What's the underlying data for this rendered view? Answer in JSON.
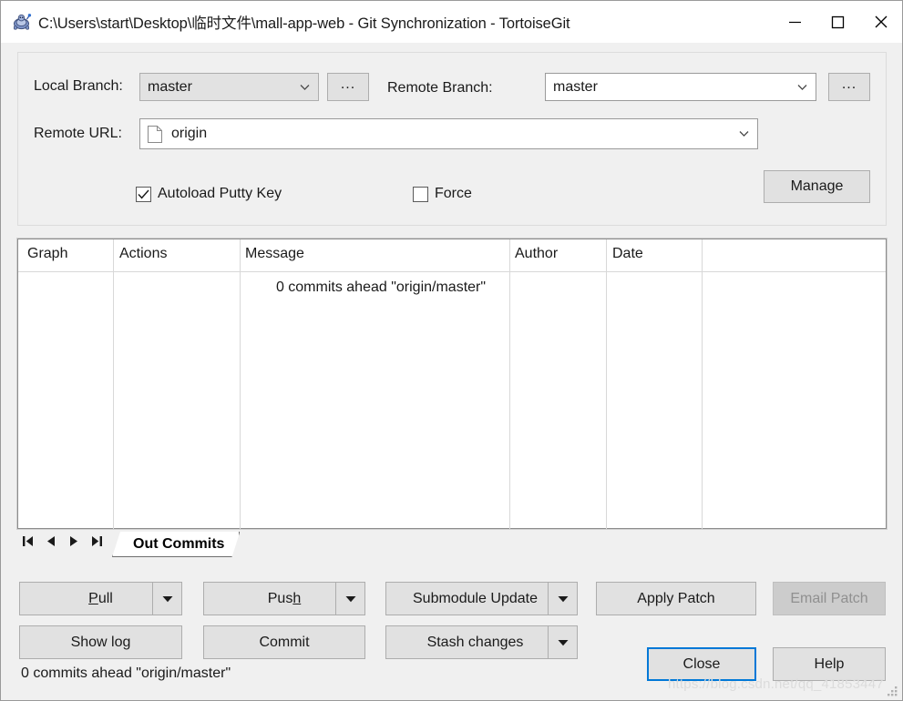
{
  "window": {
    "title": "C:\\Users\\start\\Desktop\\临时文件\\mall-app-web - Git Synchronization - TortoiseGit",
    "app_icon": "tortoisegit-turtle-icon",
    "minimize_label": "—",
    "maximize_label": "☐",
    "close_label": "✕"
  },
  "settings": {
    "local_branch": {
      "label": "Local Branch:",
      "value": "master"
    },
    "local_branch_browse": {
      "label": "..."
    },
    "remote_branch": {
      "label": "Remote Branch:",
      "value": "master"
    },
    "remote_branch_browse": {
      "label": "..."
    },
    "remote_url": {
      "label": "Remote URL:",
      "value": "origin",
      "icon": "document-icon"
    },
    "manage_button": {
      "label": "Manage"
    },
    "autoload_putty_key": {
      "label": "Autoload Putty Key",
      "checked": true,
      "mark": "✓"
    },
    "force": {
      "label": "Force",
      "checked": false,
      "mark": ""
    }
  },
  "commit_list": {
    "columns": [
      "Graph",
      "Actions",
      "Message",
      "Author",
      "Date"
    ],
    "rows": [],
    "empty_message": "0 commits ahead \"origin/master\""
  },
  "tabs": {
    "nav": {
      "first": "⏮",
      "prev": "◀",
      "next": "▶",
      "last": "⏭"
    },
    "active_tab": "Out Commits"
  },
  "actions": {
    "pull": {
      "label": "Pull",
      "accel": "P",
      "has_dropdown": true,
      "dropdown": "▼"
    },
    "push": {
      "label": "Push",
      "accel": "h",
      "has_dropdown": true,
      "dropdown": "▼"
    },
    "submodule_update": {
      "label": "Submodule Update",
      "has_dropdown": true,
      "dropdown": "▼"
    },
    "apply_patch": {
      "label": "Apply Patch"
    },
    "email_patch": {
      "label": "Email Patch",
      "disabled": true
    },
    "show_log": {
      "label": "Show log"
    },
    "commit": {
      "label": "Commit"
    },
    "stash_changes": {
      "label": "Stash changes",
      "has_dropdown": true,
      "dropdown": "▼"
    },
    "close": {
      "label": "Close",
      "is_default": true
    },
    "help": {
      "label": "Help"
    }
  },
  "statusbar": {
    "text": "0 commits ahead \"origin/master\"",
    "watermark": "https://blog.csdn.net/qq_41853447"
  },
  "colors": {
    "accent": "#0078d7",
    "panel": "#f0f0f0",
    "button": "#e1e1e1",
    "disabled_text": "#909090"
  }
}
